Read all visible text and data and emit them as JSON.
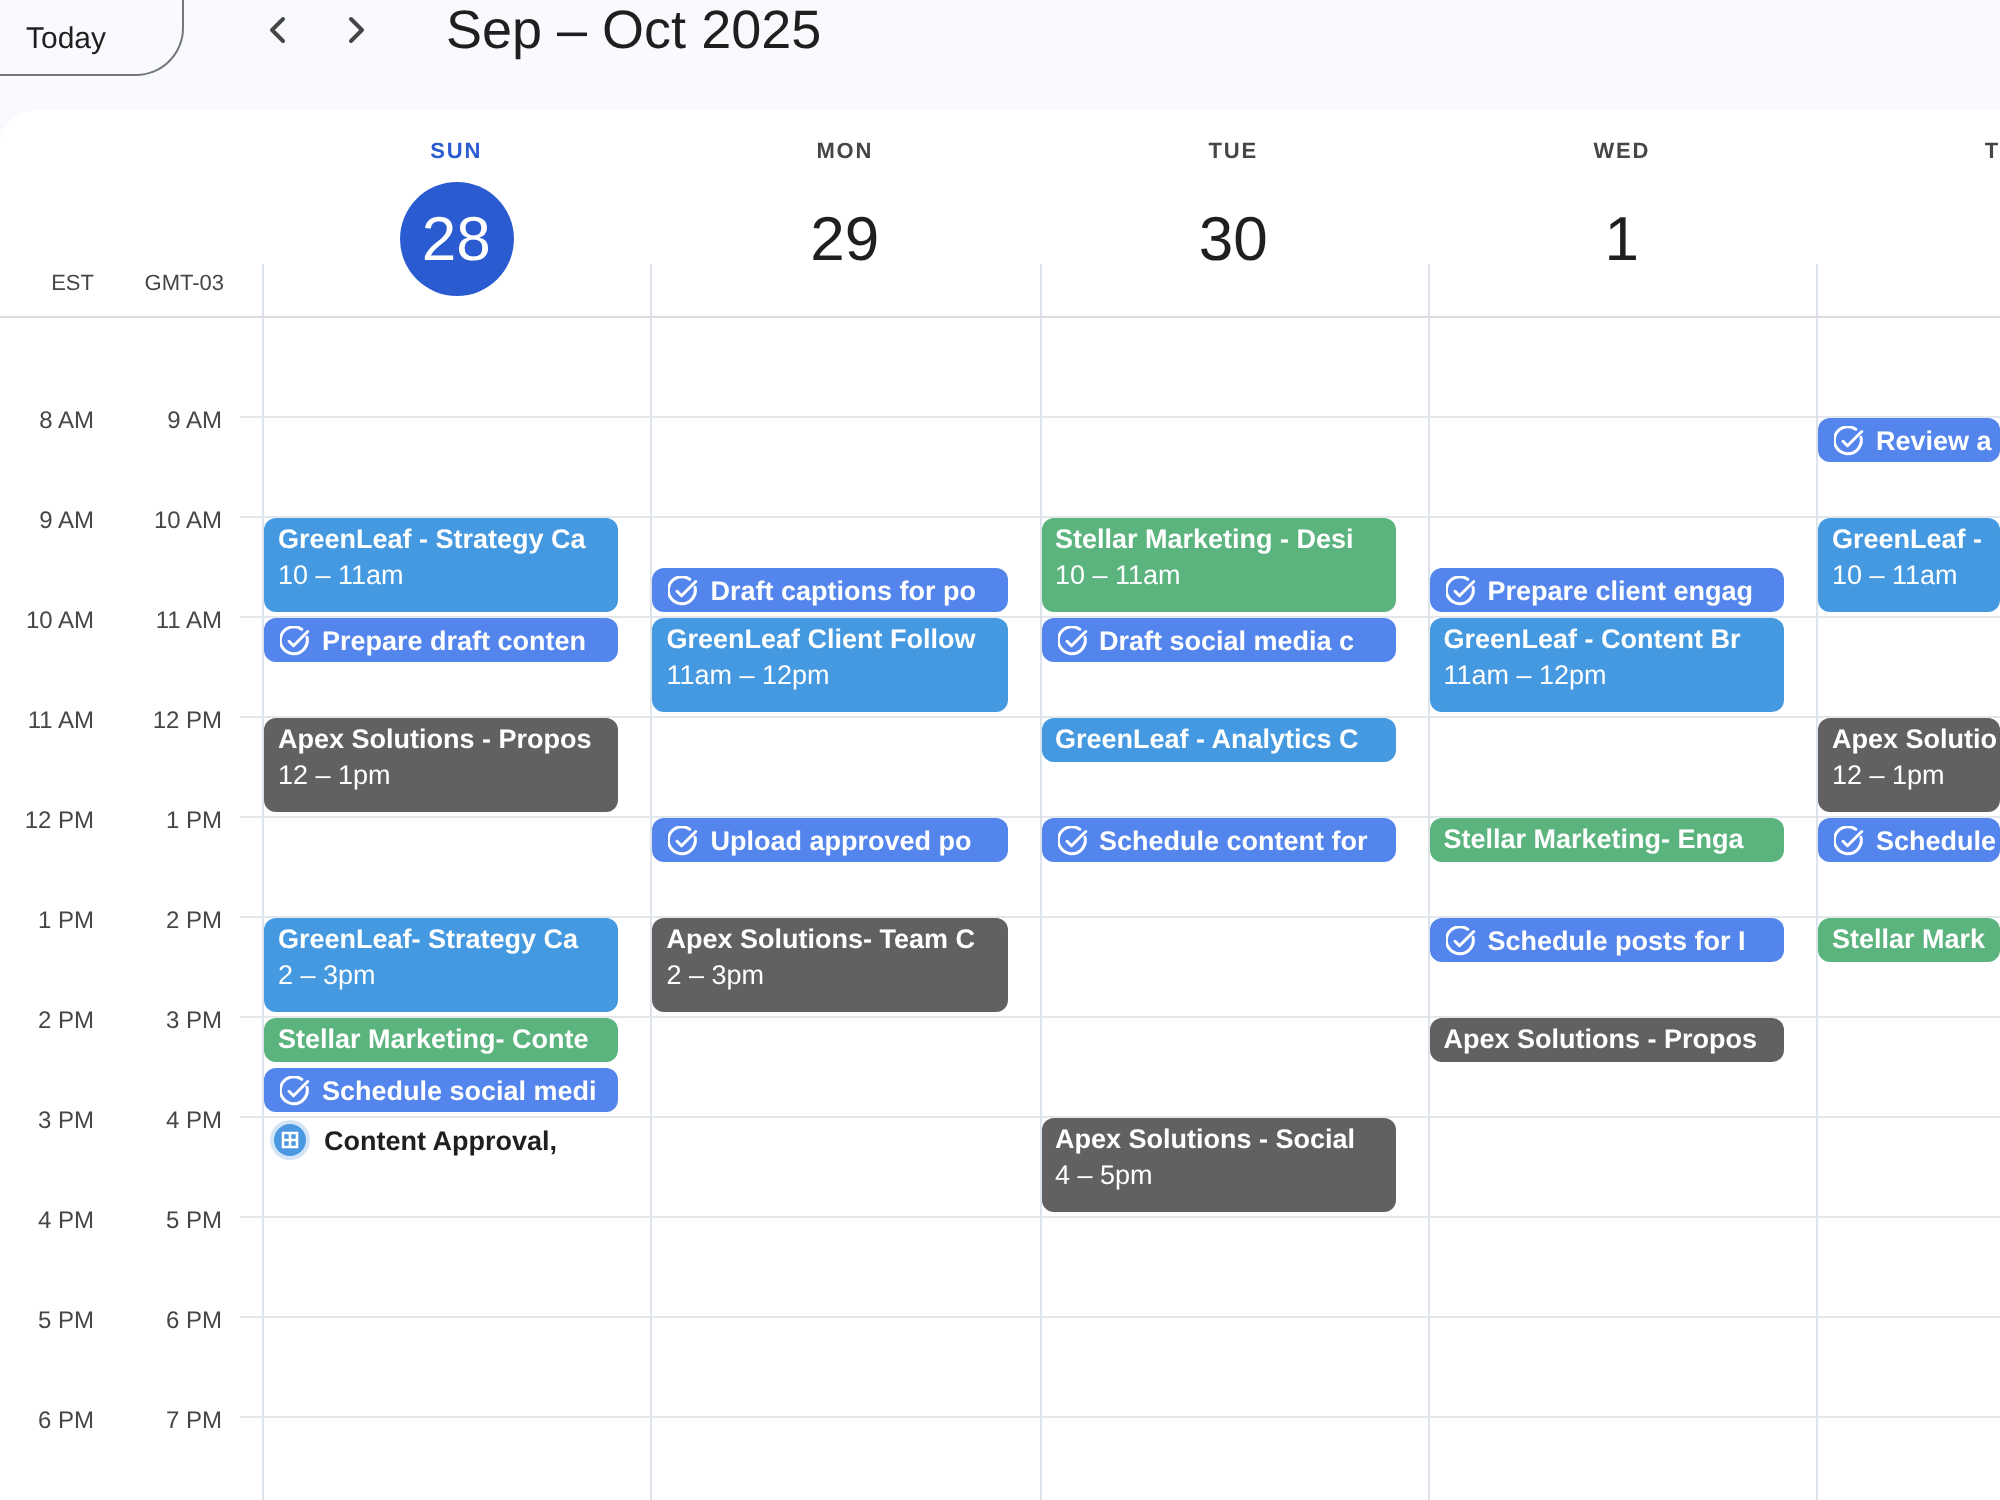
{
  "toolbar": {
    "today_button": "Today",
    "title": "Sep – Oct 2025"
  },
  "timezones": [
    "EST",
    "GMT-03"
  ],
  "time_labels": [
    {
      "est": "8 AM",
      "gmt": "9 AM"
    },
    {
      "est": "9 AM",
      "gmt": "10 AM"
    },
    {
      "est": "10 AM",
      "gmt": "11 AM"
    },
    {
      "est": "11 AM",
      "gmt": "12 PM"
    },
    {
      "est": "12 PM",
      "gmt": "1 PM"
    },
    {
      "est": "1 PM",
      "gmt": "2 PM"
    },
    {
      "est": "2 PM",
      "gmt": "3 PM"
    },
    {
      "est": "3 PM",
      "gmt": "4 PM"
    },
    {
      "est": "4 PM",
      "gmt": "5 PM"
    },
    {
      "est": "5 PM",
      "gmt": "6 PM"
    },
    {
      "est": "6 PM",
      "gmt": "7 PM"
    }
  ],
  "days": [
    {
      "name": "SUN",
      "date": "28",
      "selected": true,
      "events": [
        {
          "kind": "event",
          "title": "GreenLeaf - Strategy Ca",
          "time": "10 – 11am",
          "color": "#4599e0"
        },
        {
          "kind": "task",
          "title": "Prepare draft conten"
        },
        {
          "kind": "event",
          "title": "Apex Solutions - Propos",
          "time": "12 – 1pm",
          "color": "#616161"
        },
        {
          "kind": "event",
          "title": "GreenLeaf- Strategy Ca",
          "time": "2 – 3pm",
          "color": "#4599e0"
        },
        {
          "kind": "event",
          "title": "Stellar Marketing- Conte",
          "color": "#5bb37e"
        },
        {
          "kind": "task",
          "title": "Schedule social medi"
        },
        {
          "kind": "appointment",
          "title": "Content Approval,"
        }
      ]
    },
    {
      "name": "MON",
      "date": "29",
      "selected": false,
      "events": [
        {
          "kind": "task",
          "title": "Draft captions for po"
        },
        {
          "kind": "event",
          "title": "GreenLeaf Client Follow",
          "time": "11am – 12pm",
          "color": "#4599e0"
        },
        {
          "kind": "task",
          "title": "Upload approved po"
        },
        {
          "kind": "event",
          "title": "Apex Solutions- Team C",
          "time": "2 – 3pm",
          "color": "#616161"
        }
      ]
    },
    {
      "name": "TUE",
      "date": "30",
      "selected": false,
      "events": [
        {
          "kind": "event",
          "title": "Stellar Marketing - Desi",
          "time": "10 – 11am",
          "color": "#5bb37e"
        },
        {
          "kind": "task",
          "title": "Draft social media c"
        },
        {
          "kind": "event",
          "title": "GreenLeaf - Analytics C",
          "color": "#4599e0"
        },
        {
          "kind": "task",
          "title": "Schedule content for"
        },
        {
          "kind": "event",
          "title": "Apex Solutions - Social",
          "time": "4 – 5pm",
          "color": "#616161"
        }
      ]
    },
    {
      "name": "WED",
      "date": "1",
      "selected": false,
      "events": [
        {
          "kind": "task",
          "title": "Prepare client engag"
        },
        {
          "kind": "event",
          "title": "GreenLeaf - Content Br",
          "time": "11am – 12pm",
          "color": "#4599e0"
        },
        {
          "kind": "event",
          "title": "Stellar Marketing- Enga",
          "color": "#5bb37e"
        },
        {
          "kind": "task",
          "title": "Schedule posts for I"
        },
        {
          "kind": "event",
          "title": "Apex Solutions - Propos",
          "color": "#616161"
        }
      ]
    },
    {
      "name": "T",
      "selected": false,
      "events": [
        {
          "kind": "task",
          "title": "Review a"
        },
        {
          "kind": "event",
          "title": "GreenLeaf -",
          "time": "10 – 11am",
          "color": "#4599e0"
        },
        {
          "kind": "event",
          "title": "Apex Solutio",
          "time": "12 – 1pm",
          "color": "#616161"
        },
        {
          "kind": "task",
          "title": "Schedule"
        },
        {
          "kind": "event",
          "title": "Stellar Mark",
          "color": "#5bb37e"
        }
      ]
    }
  ]
}
